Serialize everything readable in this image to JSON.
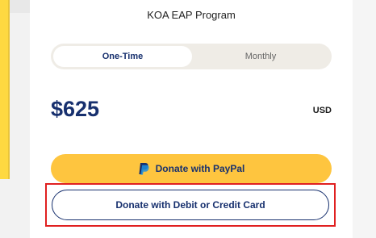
{
  "program": {
    "name": "KOA EAP Program"
  },
  "frequency": {
    "options": [
      "One-Time",
      "Monthly"
    ],
    "selected": "One-Time"
  },
  "amount": {
    "value": "$625",
    "currency": "USD"
  },
  "buttons": {
    "paypal_label": "Donate with PayPal",
    "card_label": "Donate with Debit or Credit Card"
  },
  "colors": {
    "brand_navy": "#17306e",
    "paypal_yellow": "#fec53f",
    "highlight_red": "#e02020",
    "side_yellow": "#fed941"
  },
  "icons": {
    "paypal": "paypal-icon"
  }
}
